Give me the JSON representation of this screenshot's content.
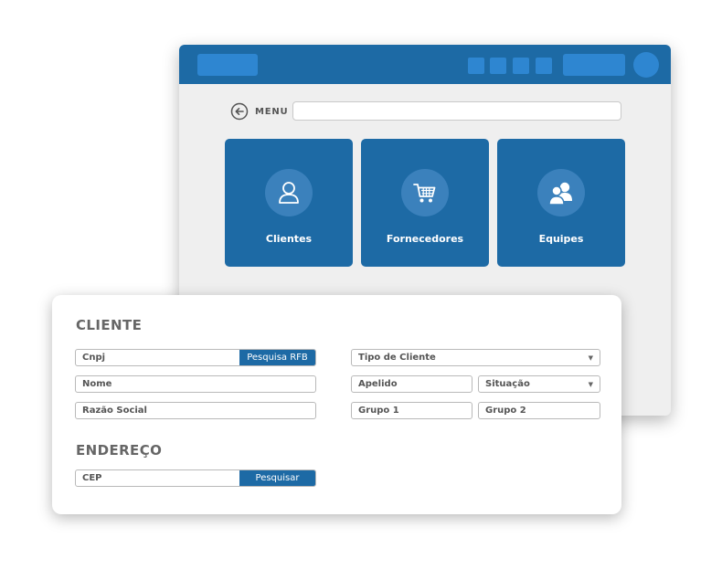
{
  "menu": {
    "label": "MENU"
  },
  "tiles": [
    {
      "label": "Clientes",
      "icon": "user-icon"
    },
    {
      "label": "Fornecedores",
      "icon": "cart-icon"
    },
    {
      "label": "Equipes",
      "icon": "team-icon"
    }
  ],
  "cliente": {
    "title": "CLIENTE",
    "cnpj_placeholder": "Cnpj",
    "pesquisa_rfb_label": "Pesquisa RFB",
    "nome_placeholder": "Nome",
    "razao_social_placeholder": "Razão Social",
    "tipo_cliente_placeholder": "Tipo de Cliente",
    "apelido_placeholder": "Apelido",
    "situacao_placeholder": "Situação",
    "grupo1_placeholder": "Grupo 1",
    "grupo2_placeholder": "Grupo 2",
    "dropdown_caret": "▼"
  },
  "endereco": {
    "title": "ENDEREÇO",
    "cep_placeholder": "CEP",
    "pesquisar_label": "Pesquisar"
  },
  "colors": {
    "primary": "#1d6aa5",
    "accent": "#2e86d1",
    "icon_circle": "#3b81bc",
    "window_bg": "#efefef"
  }
}
